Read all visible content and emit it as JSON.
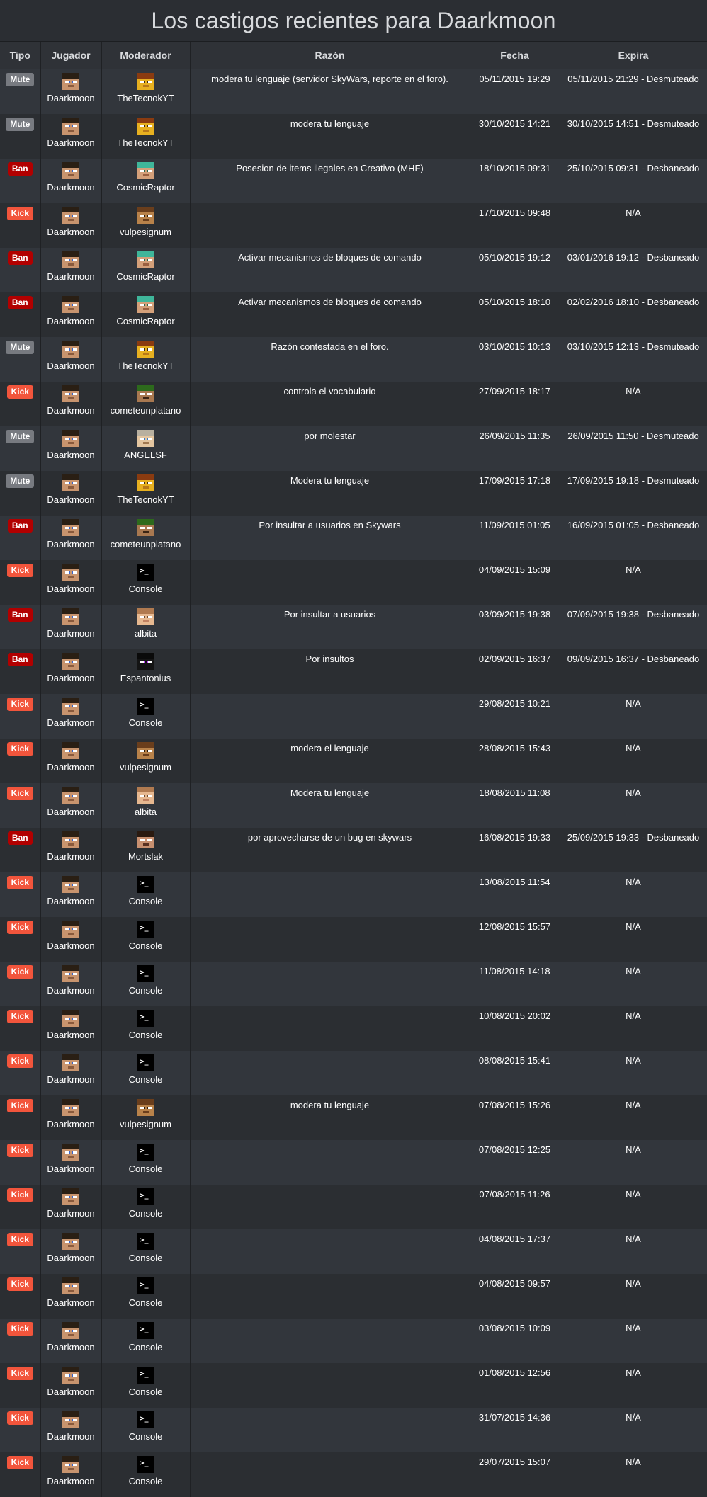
{
  "page": {
    "title": "Los castigos recientes para Daarkmoon"
  },
  "columns": [
    "Tipo",
    "Jugador",
    "Moderador",
    "Razón",
    "Fecha",
    "Expira"
  ],
  "colors": {
    "mute": "#777a80",
    "ban": "#b20000",
    "kick": "#f2553c",
    "row_odd": "#32363c",
    "row_even": "#2b2e32"
  },
  "rows": [
    {
      "type": "Mute",
      "player": "Daarkmoon",
      "moderator": "TheTecnokYT",
      "reason": "modera tu lenguaje (servidor SkyWars, reporte en el foro).",
      "date": "05/11/2015 19:29",
      "expires": "05/11/2015 21:29 - Desmuteado"
    },
    {
      "type": "Mute",
      "player": "Daarkmoon",
      "moderator": "TheTecnokYT",
      "reason": "modera tu lenguaje",
      "date": "30/10/2015 14:21",
      "expires": "30/10/2015 14:51 - Desmuteado"
    },
    {
      "type": "Ban",
      "player": "Daarkmoon",
      "moderator": "CosmicRaptor",
      "reason": "Posesion de items ilegales en Creativo (MHF)",
      "date": "18/10/2015 09:31",
      "expires": "25/10/2015 09:31 - Desbaneado"
    },
    {
      "type": "Kick",
      "player": "Daarkmoon",
      "moderator": "vulpesignum",
      "reason": "",
      "date": "17/10/2015 09:48",
      "expires": "N/A"
    },
    {
      "type": "Ban",
      "player": "Daarkmoon",
      "moderator": "CosmicRaptor",
      "reason": "Activar mecanismos de bloques de comando",
      "date": "05/10/2015 19:12",
      "expires": "03/01/2016 19:12 - Desbaneado"
    },
    {
      "type": "Ban",
      "player": "Daarkmoon",
      "moderator": "CosmicRaptor",
      "reason": "Activar mecanismos de bloques de comando",
      "date": "05/10/2015 18:10",
      "expires": "02/02/2016 18:10 - Desbaneado"
    },
    {
      "type": "Mute",
      "player": "Daarkmoon",
      "moderator": "TheTecnokYT",
      "reason": "Razón contestada en el foro.",
      "date": "03/10/2015 10:13",
      "expires": "03/10/2015 12:13 - Desmuteado"
    },
    {
      "type": "Kick",
      "player": "Daarkmoon",
      "moderator": "cometeunplatano",
      "reason": "controla el vocabulario",
      "date": "27/09/2015 18:17",
      "expires": "N/A"
    },
    {
      "type": "Mute",
      "player": "Daarkmoon",
      "moderator": "ANGELSF",
      "reason": "por molestar",
      "date": "26/09/2015 11:35",
      "expires": "26/09/2015 11:50 - Desmuteado"
    },
    {
      "type": "Mute",
      "player": "Daarkmoon",
      "moderator": "TheTecnokYT",
      "reason": "Modera tu lenguaje",
      "date": "17/09/2015 17:18",
      "expires": "17/09/2015 19:18 - Desmuteado"
    },
    {
      "type": "Ban",
      "player": "Daarkmoon",
      "moderator": "cometeunplatano",
      "reason": "Por insultar a usuarios en Skywars",
      "date": "11/09/2015 01:05",
      "expires": "16/09/2015 01:05 - Desbaneado"
    },
    {
      "type": "Kick",
      "player": "Daarkmoon",
      "moderator": "Console",
      "reason": "",
      "date": "04/09/2015 15:09",
      "expires": "N/A"
    },
    {
      "type": "Ban",
      "player": "Daarkmoon",
      "moderator": "albita",
      "reason": "Por insultar a usuarios",
      "date": "03/09/2015 19:38",
      "expires": "07/09/2015 19:38 - Desbaneado"
    },
    {
      "type": "Ban",
      "player": "Daarkmoon",
      "moderator": "Espantonius",
      "reason": "Por insultos",
      "date": "02/09/2015 16:37",
      "expires": "09/09/2015 16:37 - Desbaneado"
    },
    {
      "type": "Kick",
      "player": "Daarkmoon",
      "moderator": "Console",
      "reason": "",
      "date": "29/08/2015 10:21",
      "expires": "N/A"
    },
    {
      "type": "Kick",
      "player": "Daarkmoon",
      "moderator": "vulpesignum",
      "reason": "modera el lenguaje",
      "date": "28/08/2015 15:43",
      "expires": "N/A"
    },
    {
      "type": "Kick",
      "player": "Daarkmoon",
      "moderator": "albita",
      "reason": "Modera tu lenguaje",
      "date": "18/08/2015 11:08",
      "expires": "N/A"
    },
    {
      "type": "Ban",
      "player": "Daarkmoon",
      "moderator": "Mortslak",
      "reason": "por aprovecharse de un bug en skywars",
      "date": "16/08/2015 19:33",
      "expires": "25/09/2015 19:33 - Desbaneado"
    },
    {
      "type": "Kick",
      "player": "Daarkmoon",
      "moderator": "Console",
      "reason": "",
      "date": "13/08/2015 11:54",
      "expires": "N/A"
    },
    {
      "type": "Kick",
      "player": "Daarkmoon",
      "moderator": "Console",
      "reason": "",
      "date": "12/08/2015 15:57",
      "expires": "N/A"
    },
    {
      "type": "Kick",
      "player": "Daarkmoon",
      "moderator": "Console",
      "reason": "",
      "date": "11/08/2015 14:18",
      "expires": "N/A"
    },
    {
      "type": "Kick",
      "player": "Daarkmoon",
      "moderator": "Console",
      "reason": "",
      "date": "10/08/2015 20:02",
      "expires": "N/A"
    },
    {
      "type": "Kick",
      "player": "Daarkmoon",
      "moderator": "Console",
      "reason": "",
      "date": "08/08/2015 15:41",
      "expires": "N/A"
    },
    {
      "type": "Kick",
      "player": "Daarkmoon",
      "moderator": "vulpesignum",
      "reason": "modera tu lenguaje",
      "date": "07/08/2015 15:26",
      "expires": "N/A"
    },
    {
      "type": "Kick",
      "player": "Daarkmoon",
      "moderator": "Console",
      "reason": "",
      "date": "07/08/2015 12:25",
      "expires": "N/A"
    },
    {
      "type": "Kick",
      "player": "Daarkmoon",
      "moderator": "Console",
      "reason": "",
      "date": "07/08/2015 11:26",
      "expires": "N/A"
    },
    {
      "type": "Kick",
      "player": "Daarkmoon",
      "moderator": "Console",
      "reason": "",
      "date": "04/08/2015 17:37",
      "expires": "N/A"
    },
    {
      "type": "Kick",
      "player": "Daarkmoon",
      "moderator": "Console",
      "reason": "",
      "date": "04/08/2015 09:57",
      "expires": "N/A"
    },
    {
      "type": "Kick",
      "player": "Daarkmoon",
      "moderator": "Console",
      "reason": "",
      "date": "03/08/2015 10:09",
      "expires": "N/A"
    },
    {
      "type": "Kick",
      "player": "Daarkmoon",
      "moderator": "Console",
      "reason": "",
      "date": "01/08/2015 12:56",
      "expires": "N/A"
    },
    {
      "type": "Kick",
      "player": "Daarkmoon",
      "moderator": "Console",
      "reason": "",
      "date": "31/07/2015 14:36",
      "expires": "N/A"
    },
    {
      "type": "Kick",
      "player": "Daarkmoon",
      "moderator": "Console",
      "reason": "",
      "date": "29/07/2015 15:07",
      "expires": "N/A"
    }
  ]
}
